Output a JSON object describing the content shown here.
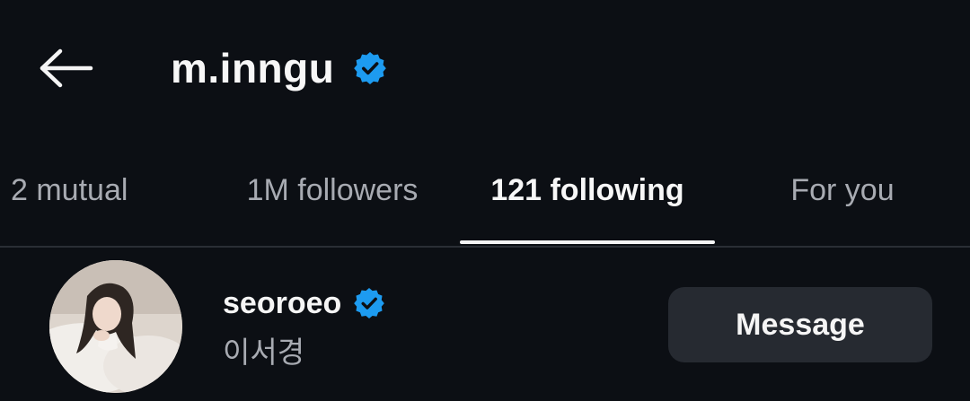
{
  "header": {
    "back_icon": "arrow-left-icon",
    "title": "m.inngu",
    "verified_icon": "verified-badge-icon",
    "verified_color": "#1d9bf0"
  },
  "tabs": [
    {
      "label": "2 mutual",
      "active": false
    },
    {
      "label": "1M followers",
      "active": false
    },
    {
      "label": "121 following",
      "active": true
    },
    {
      "label": "For you",
      "active": false
    }
  ],
  "list": {
    "items": [
      {
        "username": "seoroeo",
        "verified": true,
        "full_name": "이서경",
        "avatar_icon": "profile-photo",
        "action_label": "Message"
      }
    ]
  },
  "colors": {
    "background": "#0c0f14",
    "text_primary": "#f5f5f5",
    "text_secondary": "#a8abb2",
    "button_bg": "#262a31",
    "divider": "#2a2e35"
  }
}
